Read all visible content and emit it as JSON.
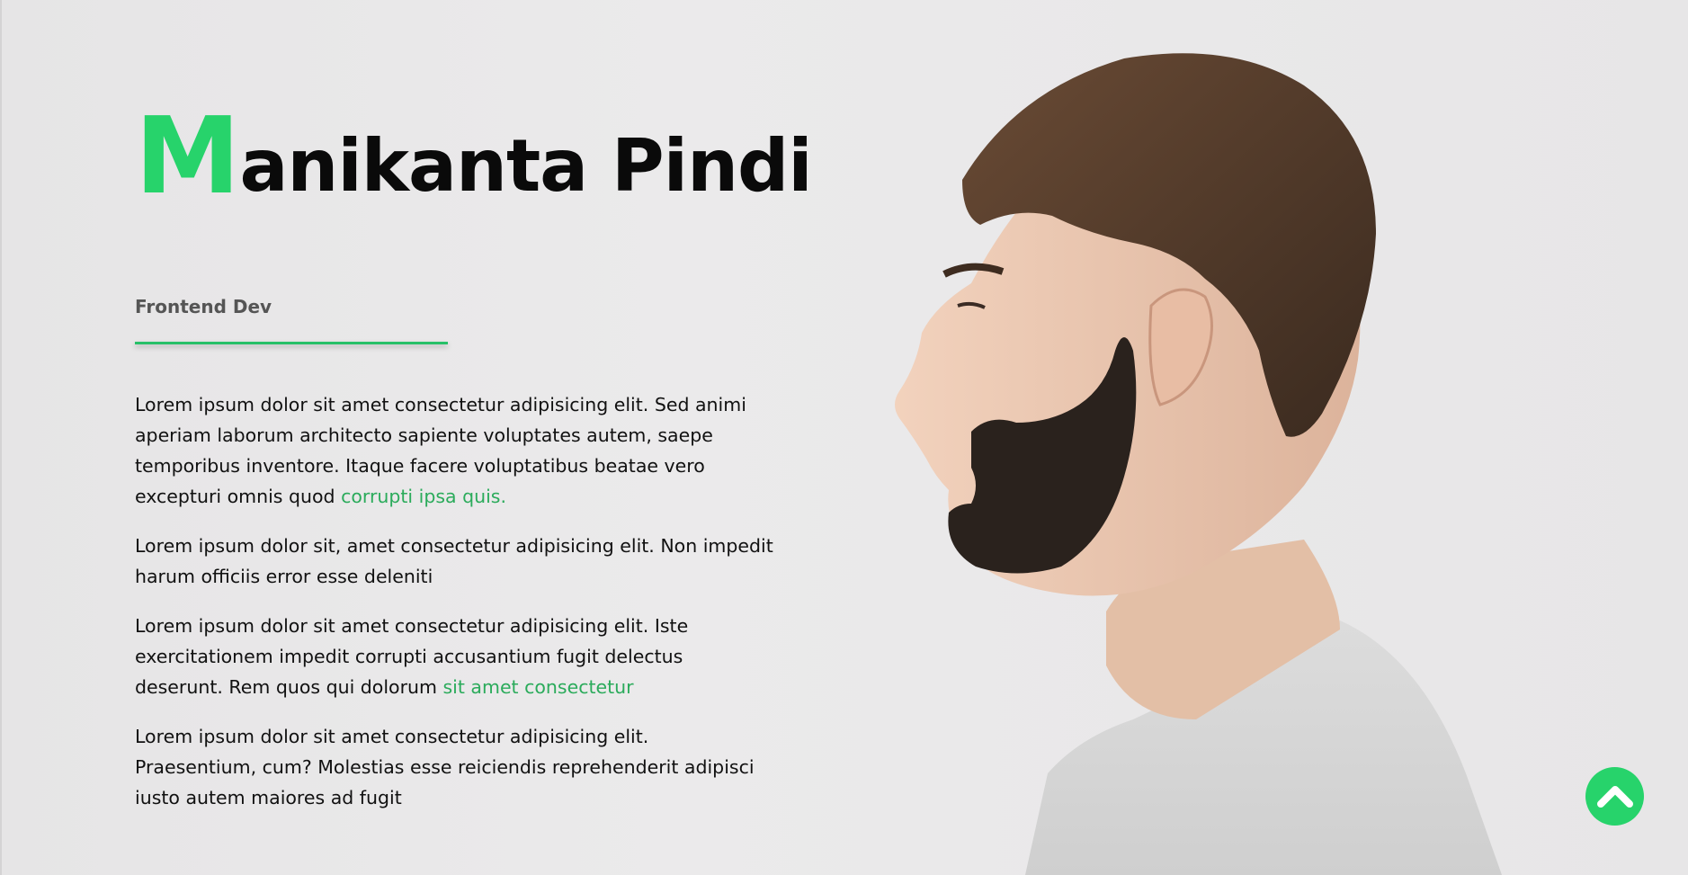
{
  "hero": {
    "name_first_letter": "M",
    "name_rest": "anikanta Pindi",
    "role": "Frontend Dev",
    "accent_color": "#27d36b",
    "link_color": "#2bab5b"
  },
  "bio": {
    "paragraphs": [
      {
        "text": "Lorem ipsum dolor sit amet consectetur adipisicing elit. Sed animi aperiam laborum architecto sapiente voluptates autem, saepe temporibus inventore. Itaque facere voluptatibus beatae vero excepturi omnis quod ",
        "link": "corrupti ipsa quis."
      },
      {
        "text": "Lorem ipsum dolor sit, amet consectetur adipisicing elit. Non impedit harum officiis error esse deleniti",
        "link": ""
      },
      {
        "text": "Lorem ipsum dolor sit amet consectetur adipisicing elit. Iste exercitationem impedit corrupti accusantium fugit delectus deserunt. Rem quos qui dolorum ",
        "link": "sit amet consectetur"
      },
      {
        "text": "Lorem ipsum dolor sit amet consectetur adipisicing elit. Praesentium, cum? Molestias esse reiciendis reprehenderit adipisci iusto autem maiores ad fugit",
        "link": ""
      }
    ]
  },
  "portrait": {
    "icon": "profile-photo"
  },
  "scroll_top": {
    "icon": "chevron-up-icon"
  }
}
